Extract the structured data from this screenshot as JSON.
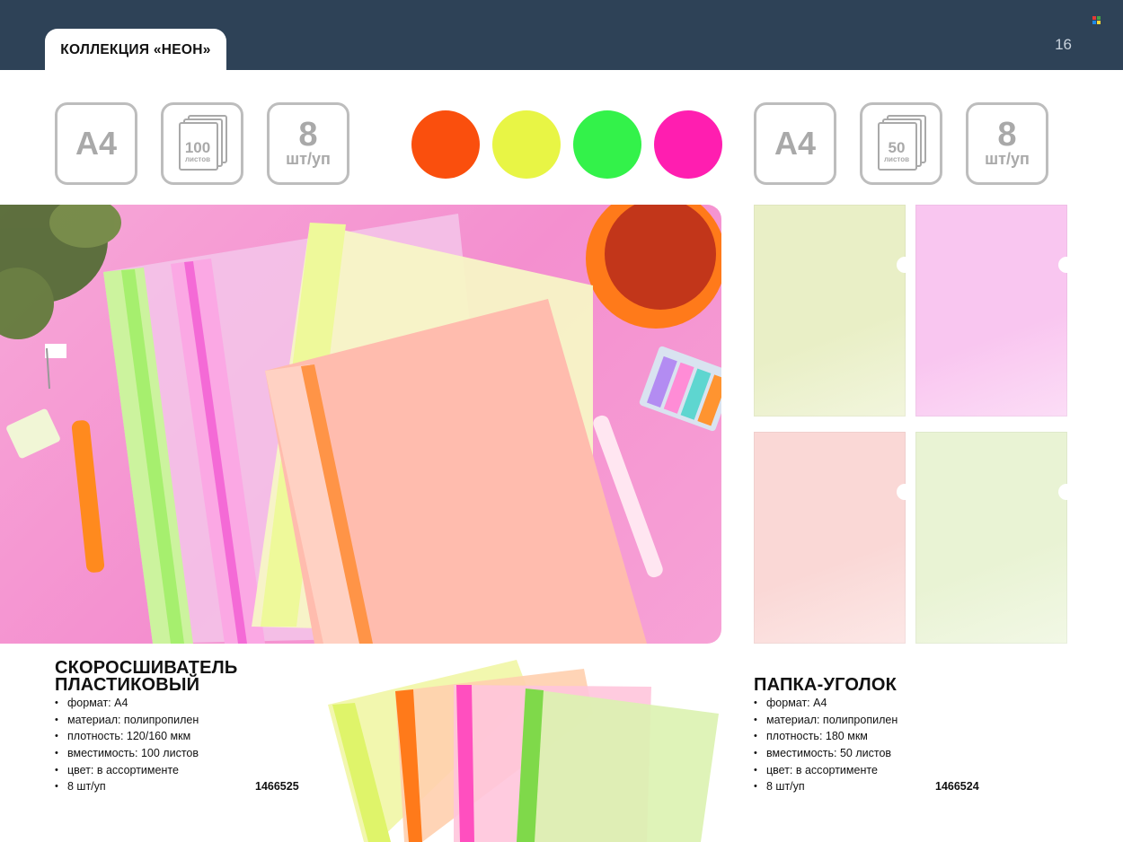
{
  "header": {
    "title": "КОЛЛЕКЦИЯ «НЕОН»",
    "page_number": "16"
  },
  "left_specs": {
    "format": "A4",
    "capacity_number": "100",
    "capacity_unit": "листов",
    "pack_number": "8",
    "pack_unit": "шт/уп"
  },
  "right_specs": {
    "format": "A4",
    "capacity_number": "50",
    "capacity_unit": "листов",
    "pack_number": "8",
    "pack_unit": "шт/уп"
  },
  "colors": [
    "#fa4f0d",
    "#e8f545",
    "#33f24a",
    "#ff1eb0"
  ],
  "product_left": {
    "title_line1": "СКОРОСШИВАТЕЛЬ",
    "title_line2": "ПЛАСТИКОВЫЙ",
    "features": [
      "формат: А4",
      "материал: полипропилен",
      "плотность: 120/160 мкм",
      "вместимость: 100 листов",
      "цвет: в ассортименте",
      "8 шт/уп"
    ],
    "sku": "1466525"
  },
  "product_right": {
    "title": "ПАПКА-УГОЛОК",
    "features": [
      "формат: А4",
      "материал: полипропилен",
      "плотность: 180 мкм",
      "вместимость: 50 листов",
      "цвет: в ассортименте",
      "8 шт/уп"
    ],
    "sku": "1466524"
  },
  "folder_sheet_colors": [
    "#e9efc6",
    "#f9c6f0",
    "#fad8d6",
    "#e9f3d4"
  ]
}
